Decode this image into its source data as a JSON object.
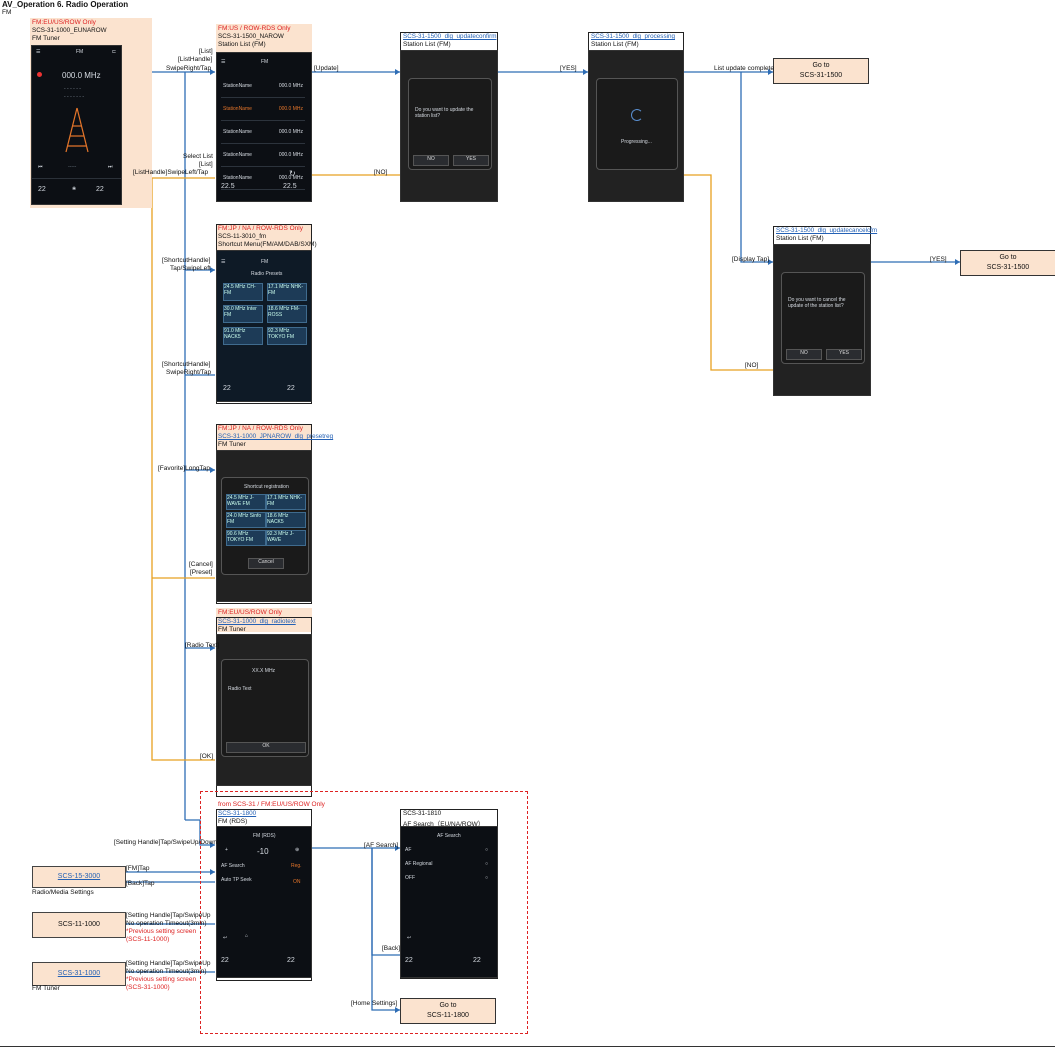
{
  "header": {
    "title": "AV_Operation 6. Radio Operation",
    "subtitle": "FM"
  },
  "screens": {
    "s1": {
      "tag": "FM:EU/US/ROW Only",
      "id": "SCS-31-1000_EUNAROW",
      "name": "FM Tuner",
      "freq": "000.0 MHz",
      "temp_l": "22",
      "temp_r": "22"
    },
    "s2": {
      "tag": "FM:US / ROW-RDS Only",
      "id": "SCS-31-1500_NAROW",
      "name": "Station List (FM)",
      "band": "FM",
      "rows": [
        "StationName",
        "StationName",
        "StationName",
        "StationName",
        "StationName",
        "StationName",
        "StationName"
      ],
      "freqs": [
        "000.0 MHz",
        "000.0 MHz",
        "000.0 MHz",
        "000.0 MHz",
        "000.0 MHz",
        "000.0 MHz",
        "000.0 MHz"
      ],
      "temp_l": "22.5",
      "temp_r": "22.5"
    },
    "s3": {
      "id": "SCS-31-1500_dlg_updateconfirm",
      "name": "Station List (FM)",
      "msg": "Do you want to update the station list?",
      "no": "NO",
      "yes": "YES"
    },
    "s4": {
      "id": "SCS-31-1500_dlg_processing",
      "name": "Station List (FM)",
      "msg": "Progressing..."
    },
    "s5": {
      "id": "SCS-31-1500_dlg_updatecancelcfm",
      "name": "Station List (FM)",
      "msg": "Do you want to cancel the update of the station list?",
      "no": "NO",
      "yes": "YES"
    },
    "s6": {
      "tag": "FM:JP / NA / ROW-RDS Only",
      "id": "SCS-11-3010_fm",
      "name": "Shortcut Menu(FM/AM/DAB/SXM)",
      "band": "FM",
      "title": "Radio Presets",
      "tiles": [
        "24.5 MHz CH-FM",
        "17.1 MHz NHK-FM",
        "30.0 MHz Inter FM",
        "18.6 MHz FM-ROSS",
        "91.0 MHz NACK5",
        "92.3 MHz TOKYO FM"
      ],
      "temp_l": "22",
      "temp_r": "22"
    },
    "s7": {
      "tag": "FM:JP / NA / ROW-RDS Only",
      "id": "SCS-31-1000_JPNAROW_dlg_presetreg",
      "name": "FM Tuner",
      "title": "Shortcut registration",
      "tiles": [
        "24.5 MHz J-WAVE FM",
        "17.1 MHz NHK-FM",
        "24.0 MHz Sinfo FM",
        "18.6 MHz NACK5",
        "90.6 MHz TOKYO FM",
        "92.3 MHz J-WAVE"
      ],
      "cancel": "Cancel"
    },
    "s8": {
      "tag": "FM:EU/US/ROW Only",
      "id": "SCS-31-1000_dlg_radiotext",
      "name": "FM Tuner",
      "line1": "XX.X MHz",
      "line2": "Radio Text",
      "ok": "OK"
    },
    "s9": {
      "tag": "from SCS-31 / FM:EU/US/ROW Only",
      "id": "SCS-31-1800",
      "name": "FM (RDS)",
      "panel_title": "FM (RDS)",
      "value": "-10",
      "item1": "AF Search",
      "item1_val": "Reg.",
      "item2": "Auto TP Seek",
      "item2_val": "ON",
      "temp_l": "22",
      "temp_r": "22"
    },
    "s10": {
      "id": "SCS-31-1810",
      "name": "AF Search（EU/NA/ROW）",
      "title": "AF Search",
      "opt1": "AF",
      "opt2": "AF Regional",
      "opt3": "OFF",
      "temp_l": "22",
      "temp_r": "22"
    }
  },
  "gotos": {
    "g1": "Go to\nSCS-31-1500",
    "g2": "Go to\nSCS-31-1500",
    "g3": "Go to\nSCS-11-1800"
  },
  "sources": {
    "src1": {
      "id": "SCS-15-3000",
      "caption": "Radio/Media Settings"
    },
    "src2": {
      "id": "SCS-11-1000"
    },
    "src3": {
      "id": "SCS-31-1000",
      "caption": "FM Tuner"
    }
  },
  "labels": {
    "list_a": "[List]",
    "list_b": "[ListHandle]",
    "list_c": "SwipeRight/Tap",
    "update": "[Update]",
    "yes1": "[YES]",
    "list_update": "List update complete",
    "sel_a": "Select List",
    "sel_b": "[List]",
    "sel_c": "[ListHandle]SwipeLeft/Tap",
    "no1": "[NO]",
    "sc1_a": "[ShortcutHandle]",
    "sc1_b": "Tap/SwipeLeft",
    "sc2_a": "[ShortcutHandle]",
    "sc2_b": "SwipeRight/Tap",
    "fav": "[Favorite]LongTap",
    "cancel_a": "[Cancel]",
    "cancel_b": "[Preset]",
    "radio_text": "[Radio Text]",
    "ok": "[OK]",
    "display_tap": "[Display Tap]",
    "yes2": "[YES]",
    "no2": "[NO]",
    "setting_swipe": "[Setting Handle]Tap/SwipeUp/Down",
    "fm_tap": "[FM]Tap",
    "back_tap": "[Back]Tap",
    "set2_a": "[Setting Handle]Tap/SwipeUp",
    "set2_b": "No operation Timeout(3min)",
    "set2_c": "*Previous setting screen",
    "set2_d": "(SCS-11-1000)",
    "set3_a": "[Setting Handle]Tap/SwipeUp",
    "set3_b": "No operation Timeout(3min)",
    "set3_c": "*Previous setting screen",
    "set3_d": "(SCS-31-1000)",
    "af_search": "[AF Search]",
    "back": "[Back]",
    "home_settings": "[Home Settings]"
  },
  "colors": {
    "blue_line": "#2e6db5",
    "orange_line": "#e8a020",
    "tag_red": "#dd2222",
    "goto_bg": "#fbe3cf"
  }
}
